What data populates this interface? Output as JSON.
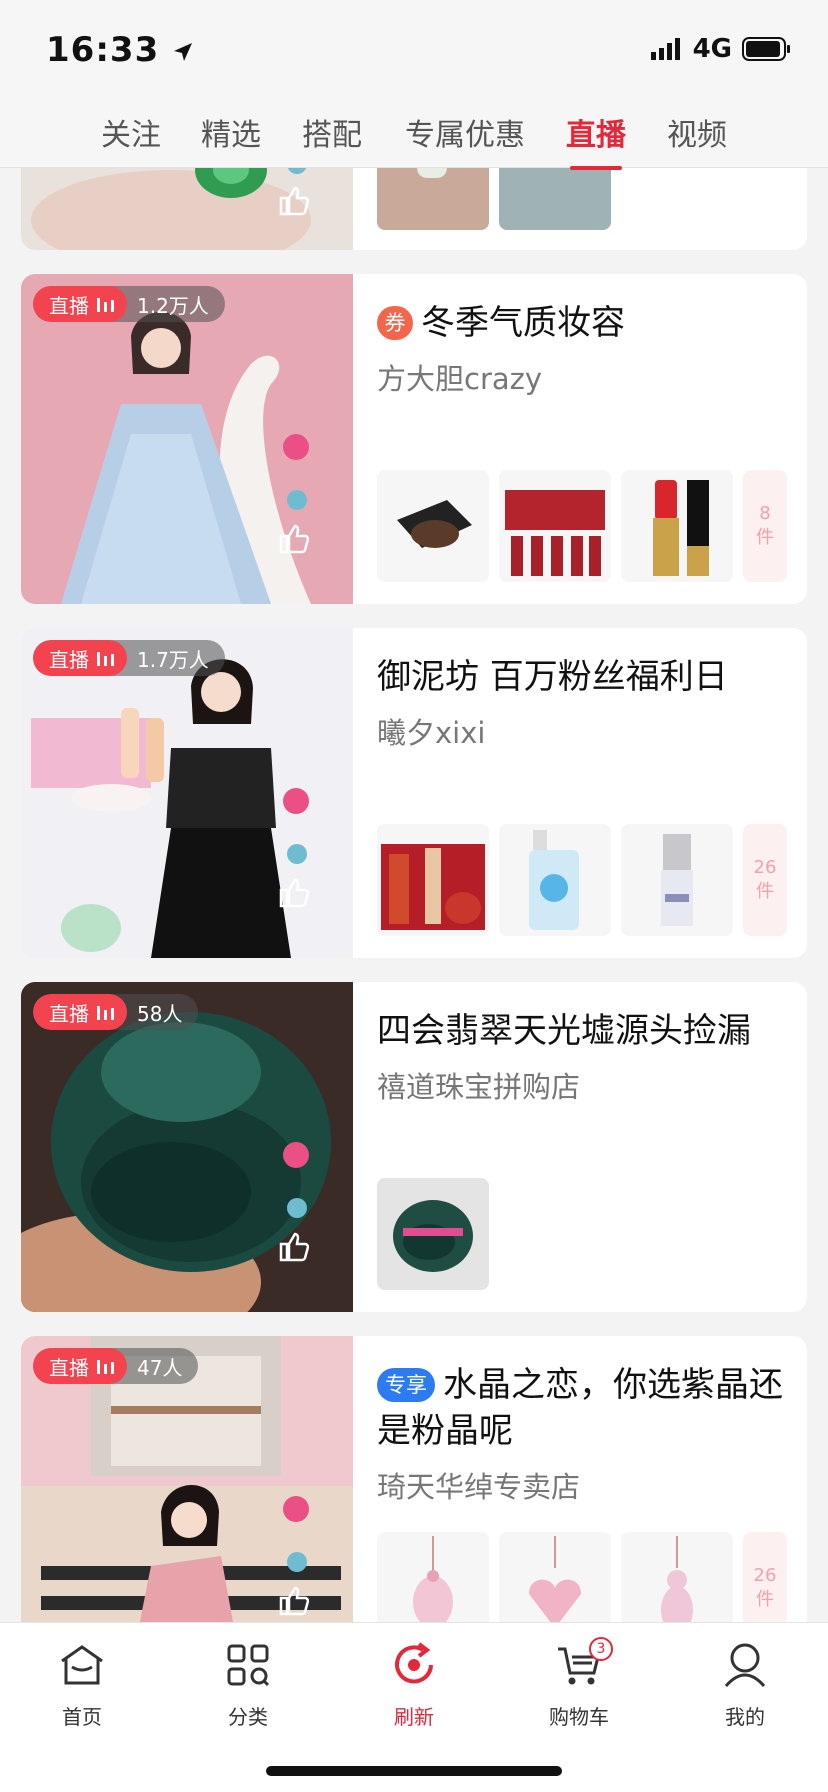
{
  "status_bar": {
    "time": "16:33",
    "network": "4G"
  },
  "tabs": [
    {
      "label": "关注"
    },
    {
      "label": "精选"
    },
    {
      "label": "搭配"
    },
    {
      "label": "专属优惠"
    },
    {
      "label": "直播",
      "active": true
    },
    {
      "label": "视频"
    }
  ],
  "feed": [
    {
      "badge": "券",
      "title": "冬季气质妆容",
      "shop": "方大胆crazy",
      "live_label": "直播",
      "viewers": "1.2万人",
      "more_count": "8",
      "more_unit": "件"
    },
    {
      "badge": "",
      "title": "御泥坊 百万粉丝福利日",
      "shop": "曦夕xixi",
      "live_label": "直播",
      "viewers": "1.7万人",
      "more_count": "26",
      "more_unit": "件"
    },
    {
      "badge": "",
      "title": "四会翡翠天光墟源头捡漏",
      "shop": "禧道珠宝拼购店",
      "live_label": "直播",
      "viewers": "58人",
      "more_count": "",
      "more_unit": ""
    },
    {
      "badge": "专享",
      "title": "水晶之恋，你选紫晶还是粉晶呢",
      "shop": "琦天华绰专卖店",
      "live_label": "直播",
      "viewers": "47人",
      "more_count": "26",
      "more_unit": "件"
    }
  ],
  "bottom_nav": {
    "home": "首页",
    "category": "分类",
    "refresh": "刷新",
    "cart": "购物车",
    "cart_count": "3",
    "mine": "我的"
  },
  "colors": {
    "accent": "#e2283a",
    "live": "#f2434f",
    "coupon": "#f3664b",
    "exclusive": "#2c7bf0"
  },
  "icons": [
    "location-arrow-icon",
    "signal-icon",
    "battery-icon",
    "live-bars-icon",
    "heart-icon",
    "thumb-up-icon",
    "home-icon",
    "category-icon",
    "refresh-icon",
    "cart-icon",
    "user-icon"
  ]
}
